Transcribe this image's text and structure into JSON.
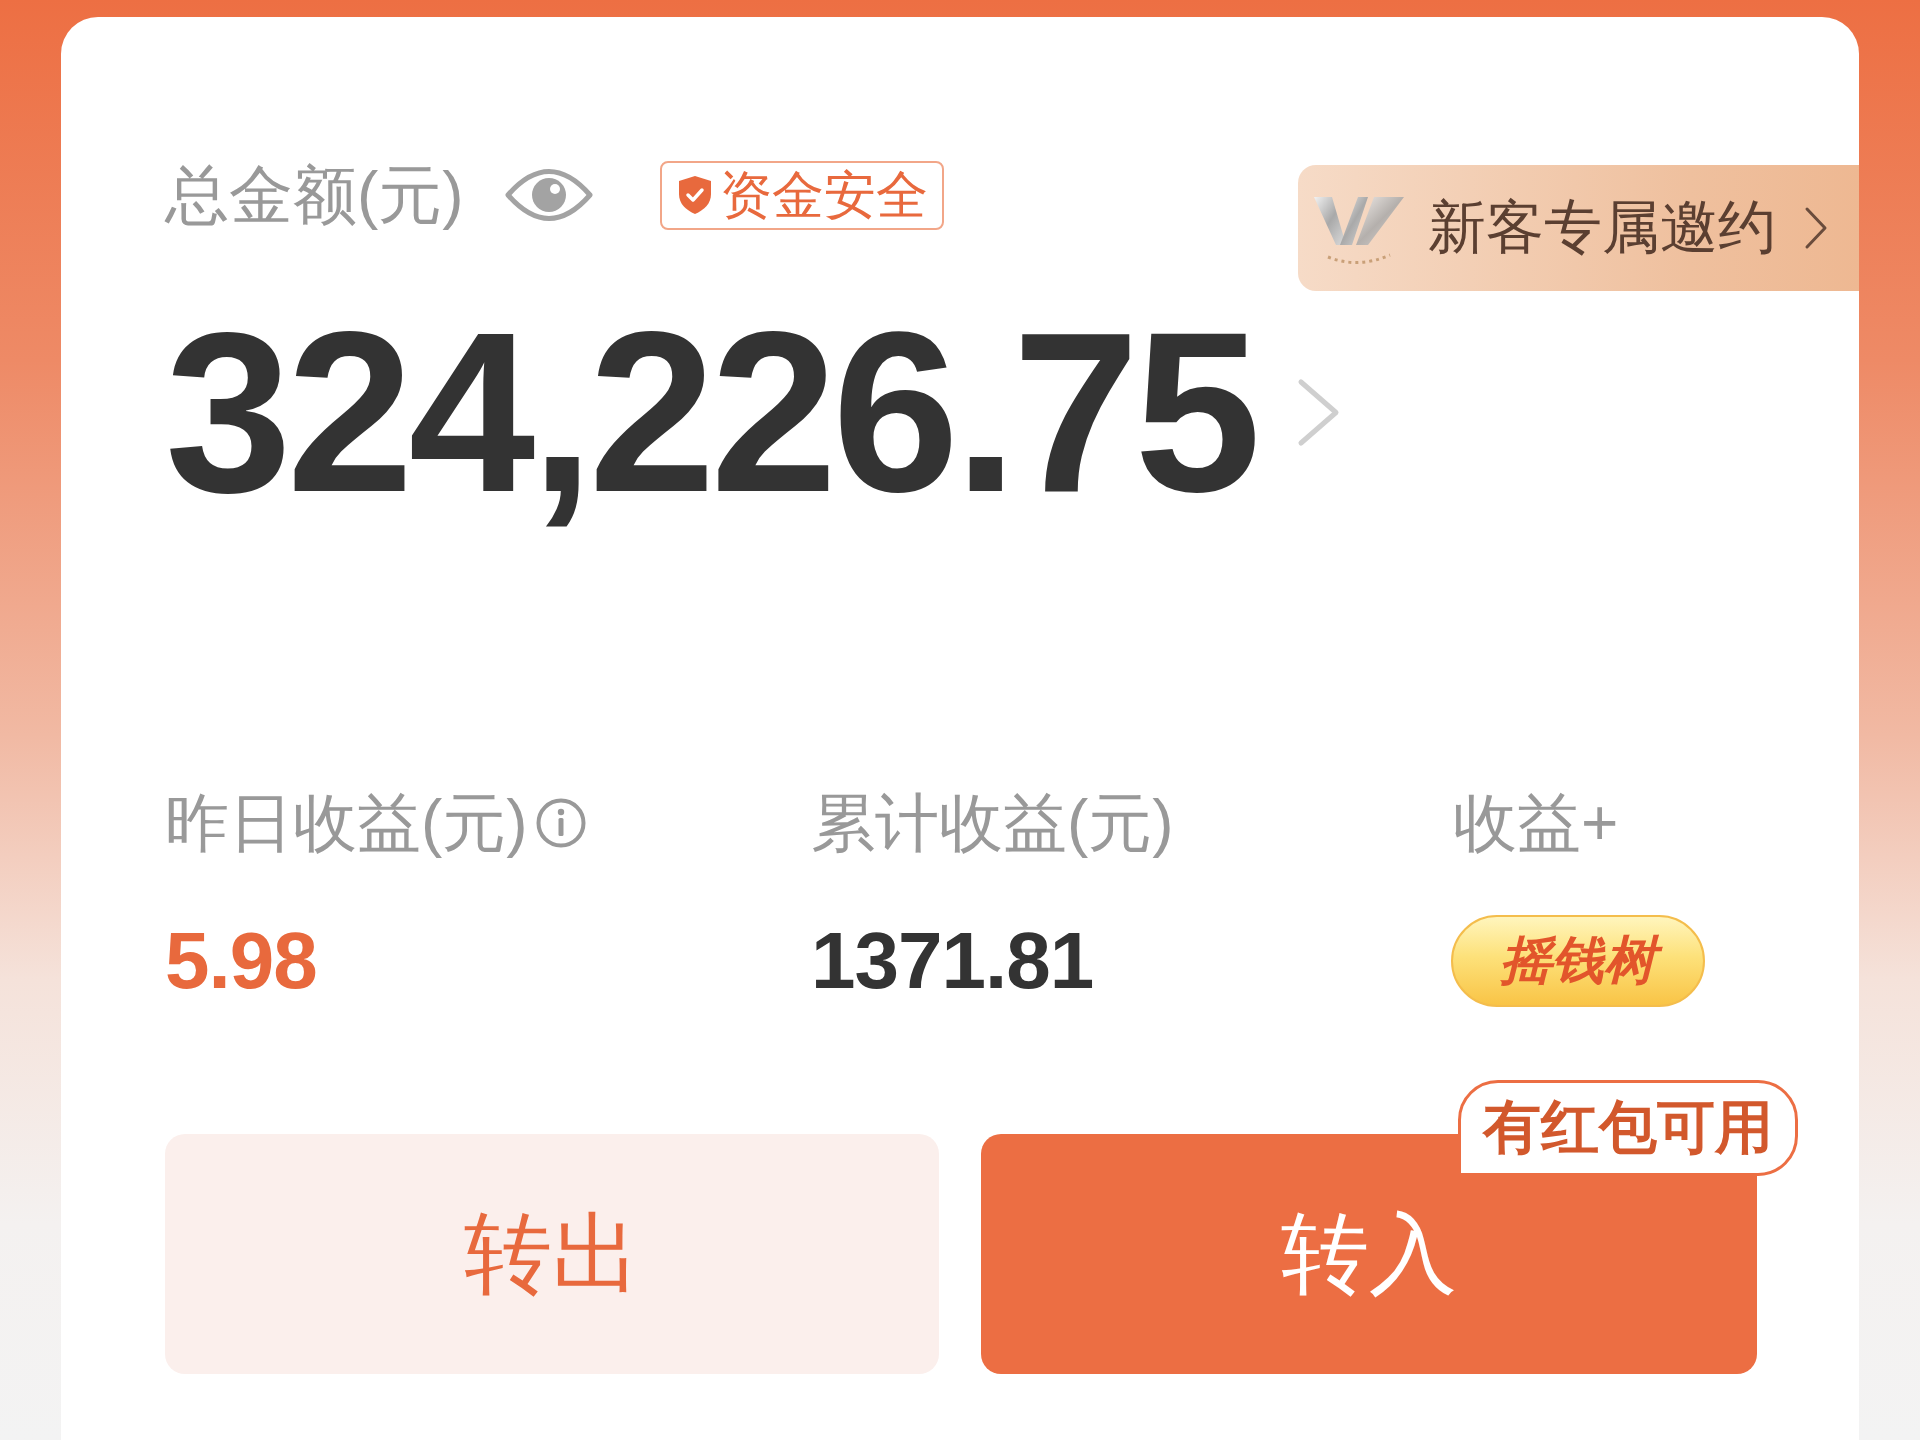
{
  "total": {
    "label": "总金额(元)",
    "badge": "资金安全",
    "amount": "324,226.75"
  },
  "promo_banner": {
    "text": "新客专属邀约"
  },
  "stats": [
    {
      "kind": "gain",
      "label": "昨日收益(元)",
      "info": true,
      "value": "5.98"
    },
    {
      "kind": "amount",
      "label": "累计收益(元)",
      "info": false,
      "value": "1371.81"
    },
    {
      "kind": "action",
      "label": "收益+",
      "info": false,
      "value": "摇钱树"
    }
  ],
  "buttons": [
    {
      "kind": "secondary",
      "label": "转出"
    },
    {
      "kind": "primary",
      "label": "转入",
      "tag": "有红包可用"
    }
  ]
}
